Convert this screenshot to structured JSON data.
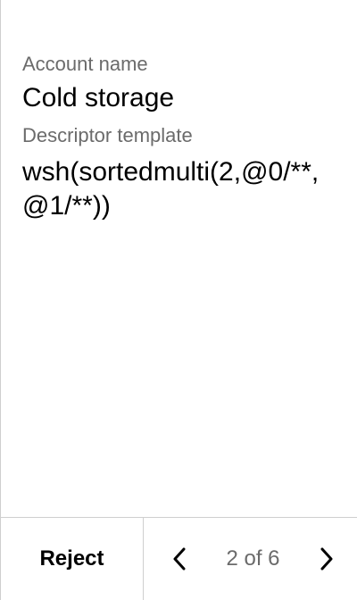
{
  "account": {
    "label": "Account name",
    "value": "Cold storage"
  },
  "descriptor": {
    "label": "Descriptor template",
    "value": "wsh(sortedmulti(2,@0/**,@1/**))"
  },
  "footer": {
    "reject_label": "Reject",
    "page_indicator": "2 of 6",
    "prev_icon": "chevron-left-icon",
    "next_icon": "chevron-right-icon"
  },
  "colors": {
    "text": "#000000",
    "muted": "#6b6b6b",
    "divider": "#cfcfcf",
    "background": "#ffffff"
  }
}
